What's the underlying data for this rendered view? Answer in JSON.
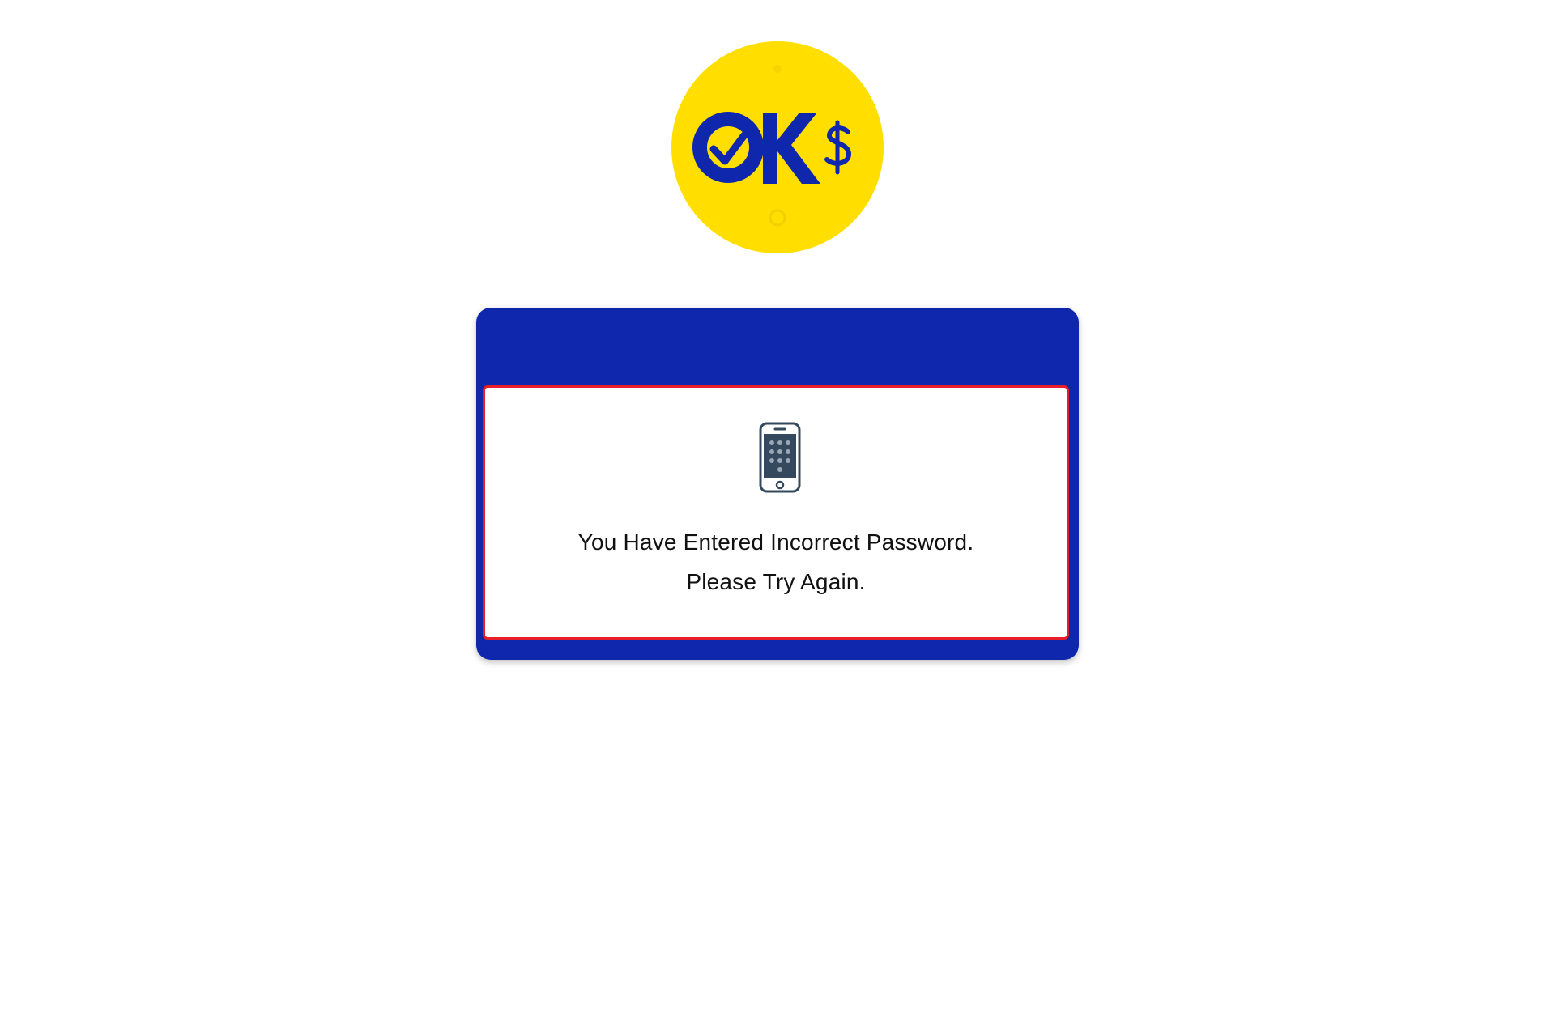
{
  "brand": {
    "logo_text": "OK$",
    "logo_icon": "ok-dollar-logo",
    "logo_bg_color": "#ffde00",
    "logo_fg_color": "#0f27ad"
  },
  "dialog": {
    "header_color": "#0f27ad",
    "border_color": "#e61e2a",
    "icon": "mobile-keypad-icon",
    "message_line1": "You Have Entered Incorrect Password.",
    "message_line2": "Please Try Again."
  }
}
